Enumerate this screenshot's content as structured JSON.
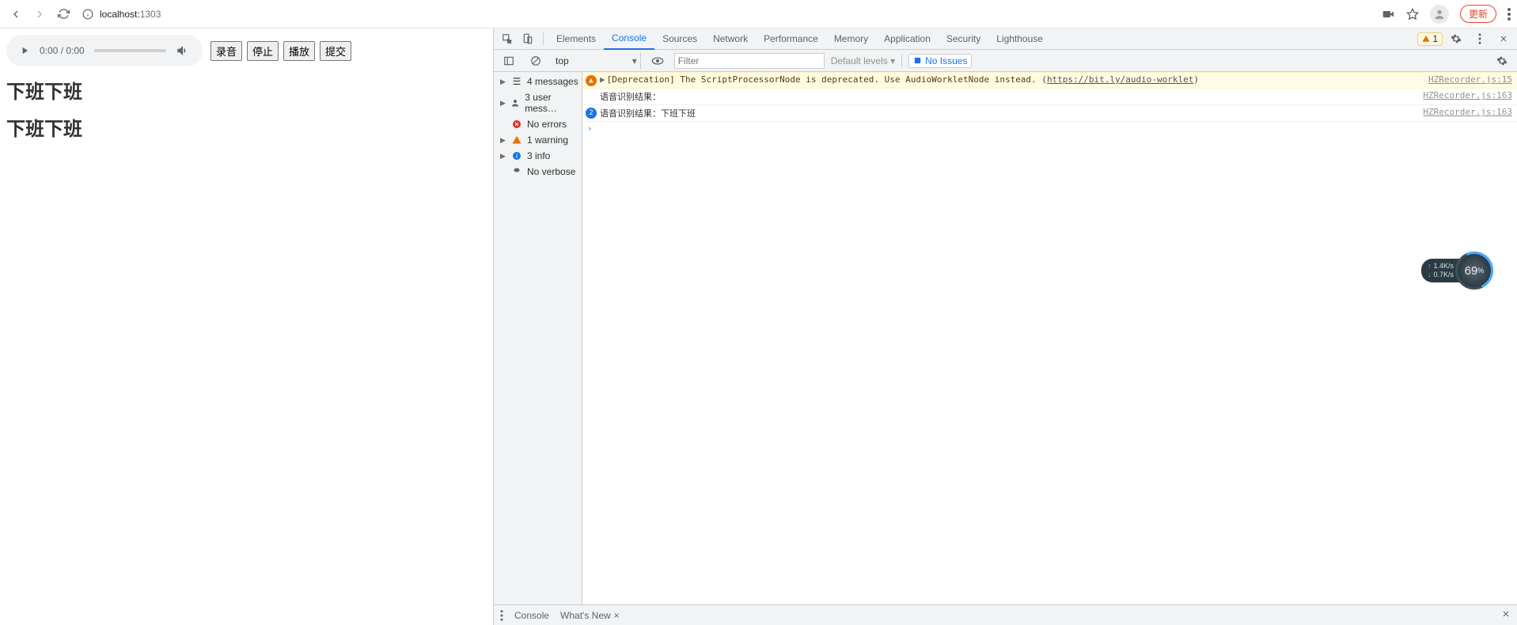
{
  "chrome": {
    "url_host": "localhost:",
    "url_port": "1303",
    "update_label": "更新"
  },
  "page": {
    "audio_time": "0:00 / 0:00",
    "buttons": {
      "record": "录音",
      "stop": "停止",
      "play": "播放",
      "submit": "提交"
    },
    "heading1": "下班下班",
    "heading2": "下班下班"
  },
  "devtools": {
    "tabs": {
      "elements": "Elements",
      "console": "Console",
      "sources": "Sources",
      "network": "Network",
      "performance": "Performance",
      "memory": "Memory",
      "application": "Application",
      "security": "Security",
      "lighthouse": "Lighthouse"
    },
    "warn_count": "1",
    "toolbar": {
      "context": "top",
      "filter_placeholder": "Filter",
      "levels": "Default levels ▾",
      "no_issues": "No Issues"
    },
    "sidebar": {
      "messages": "4 messages",
      "user": "3 user mess…",
      "errors": "No errors",
      "warnings": "1 warning",
      "info": "3 info",
      "verbose": "No verbose"
    },
    "messages": {
      "dep_prefix": "[Deprecation] ",
      "dep_text": "The ScriptProcessorNode is deprecated. Use AudioWorkletNode instead. (",
      "dep_link": "https://bit.ly/audio-worklet",
      "dep_suffix": ")",
      "dep_src": "HZRecorder.js:15",
      "r1_text": "语音识别结果：",
      "r1_src": "HZRecorder.js:163",
      "r2_count": "2",
      "r2_text": "语音识别结果：下班下班",
      "r2_src": "HZRecorder.js:163"
    },
    "drawer": {
      "console": "Console",
      "whatsnew": "What's New"
    }
  },
  "widget": {
    "up": "1.4K/s",
    "down": "0.7K/s",
    "pct": "69",
    "unit": "%"
  }
}
